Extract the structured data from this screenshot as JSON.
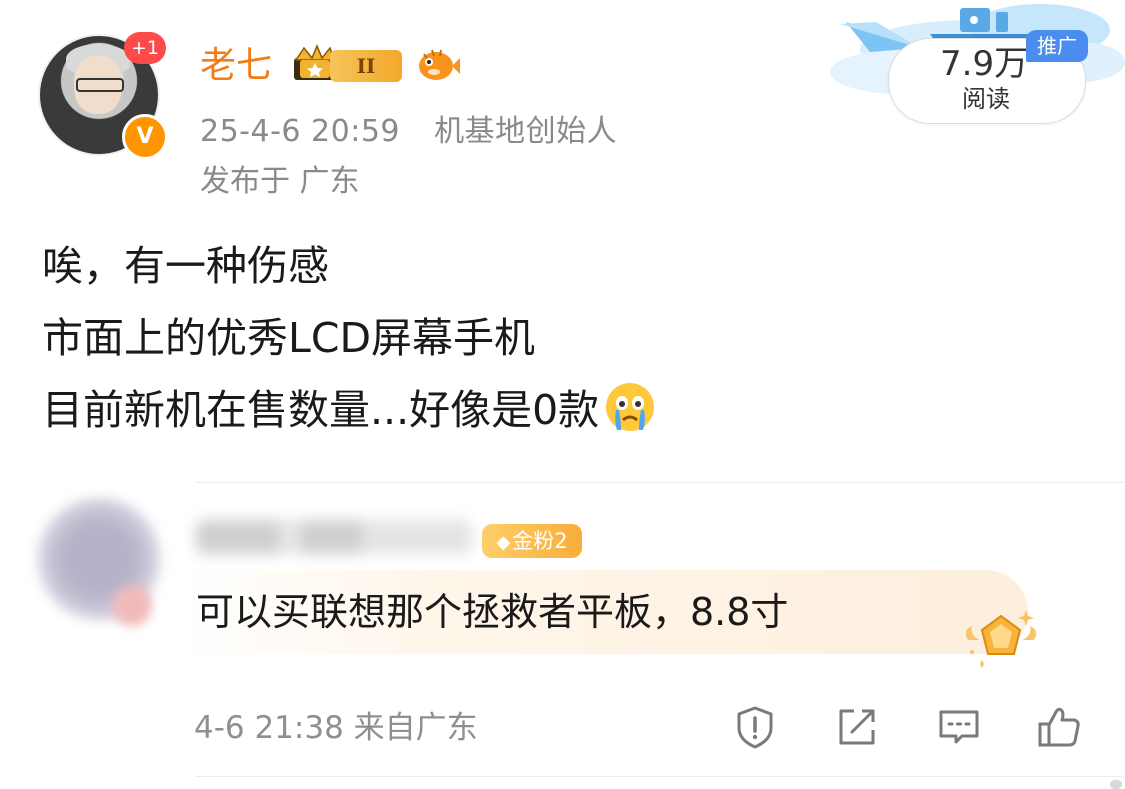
{
  "post": {
    "author_name": "老七",
    "notify_badge": "+1",
    "verified_mark": "V",
    "level_badge": "II",
    "timestamp": "25-4-6 20:59",
    "author_title": "机基地创始人",
    "location": "发布于 广东",
    "views_count": "7.9万",
    "views_label": "阅读",
    "promo_tag": "推广",
    "body_lines": [
      "唉，有一种伤感",
      "市面上的优秀LCD屏幕手机",
      "目前新机在售数量...好像是0款"
    ],
    "body_emoji": "crying-face"
  },
  "comment": {
    "fan_badge": "金粉2",
    "text": "可以买联想那个拯救者平板，8.8寸",
    "meta": "4-6 21:38 来自广东",
    "actions": [
      "report-icon",
      "share-icon",
      "comment-icon",
      "like-icon"
    ]
  },
  "colors": {
    "author_orange": "#f07d16",
    "meta_gray": "#8a8a8a",
    "promo_blue": "#4a8cf0",
    "fan_gold": "#f8ad38"
  }
}
